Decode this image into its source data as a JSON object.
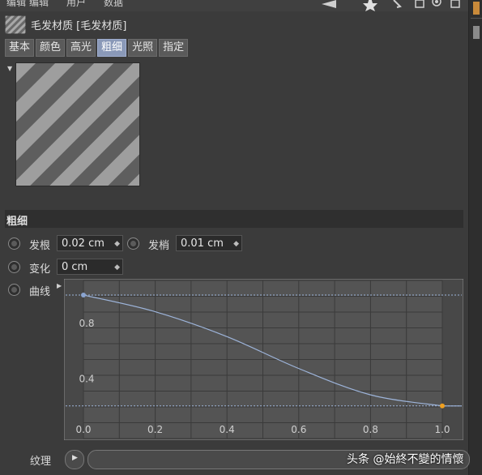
{
  "menu": {
    "items": [
      "编辑",
      "编辑",
      "用户",
      "数据"
    ]
  },
  "header": {
    "title": "毛发材质 [毛发材质]",
    "icon": "hair-material-icon"
  },
  "tabs": [
    {
      "label": "基本",
      "active": false
    },
    {
      "label": "颜色",
      "active": false
    },
    {
      "label": "高光",
      "active": false
    },
    {
      "label": "粗细",
      "active": true
    },
    {
      "label": "光照",
      "active": false
    },
    {
      "label": "指定",
      "active": false
    }
  ],
  "section": {
    "title": "粗细"
  },
  "params": {
    "root_label": "发根",
    "root_value": "0.02 cm",
    "tip_label": "发梢",
    "tip_value": "0.01 cm",
    "variation_label": "变化",
    "variation_value": "0 cm",
    "curve_label": "曲线"
  },
  "curve": {
    "x_ticks": [
      "0.0",
      "0.2",
      "0.4",
      "0.6",
      "0.8",
      "1.0"
    ],
    "y_ticks": [
      "0.8",
      "0.4"
    ],
    "points": [
      {
        "x": 0.0,
        "y": 1.0
      },
      {
        "x": 0.2,
        "y": 0.88
      },
      {
        "x": 0.4,
        "y": 0.7
      },
      {
        "x": 0.6,
        "y": 0.47
      },
      {
        "x": 0.8,
        "y": 0.28
      },
      {
        "x": 1.0,
        "y": 0.2
      }
    ],
    "start_handle_color": "#8aa4d0",
    "end_handle_color": "#f0a020",
    "line_color": "#9db4da"
  },
  "texture": {
    "label": "纹理"
  },
  "watermark": "头条 @始終不變的情懷",
  "colors": {
    "accent": "#8a99b8"
  }
}
